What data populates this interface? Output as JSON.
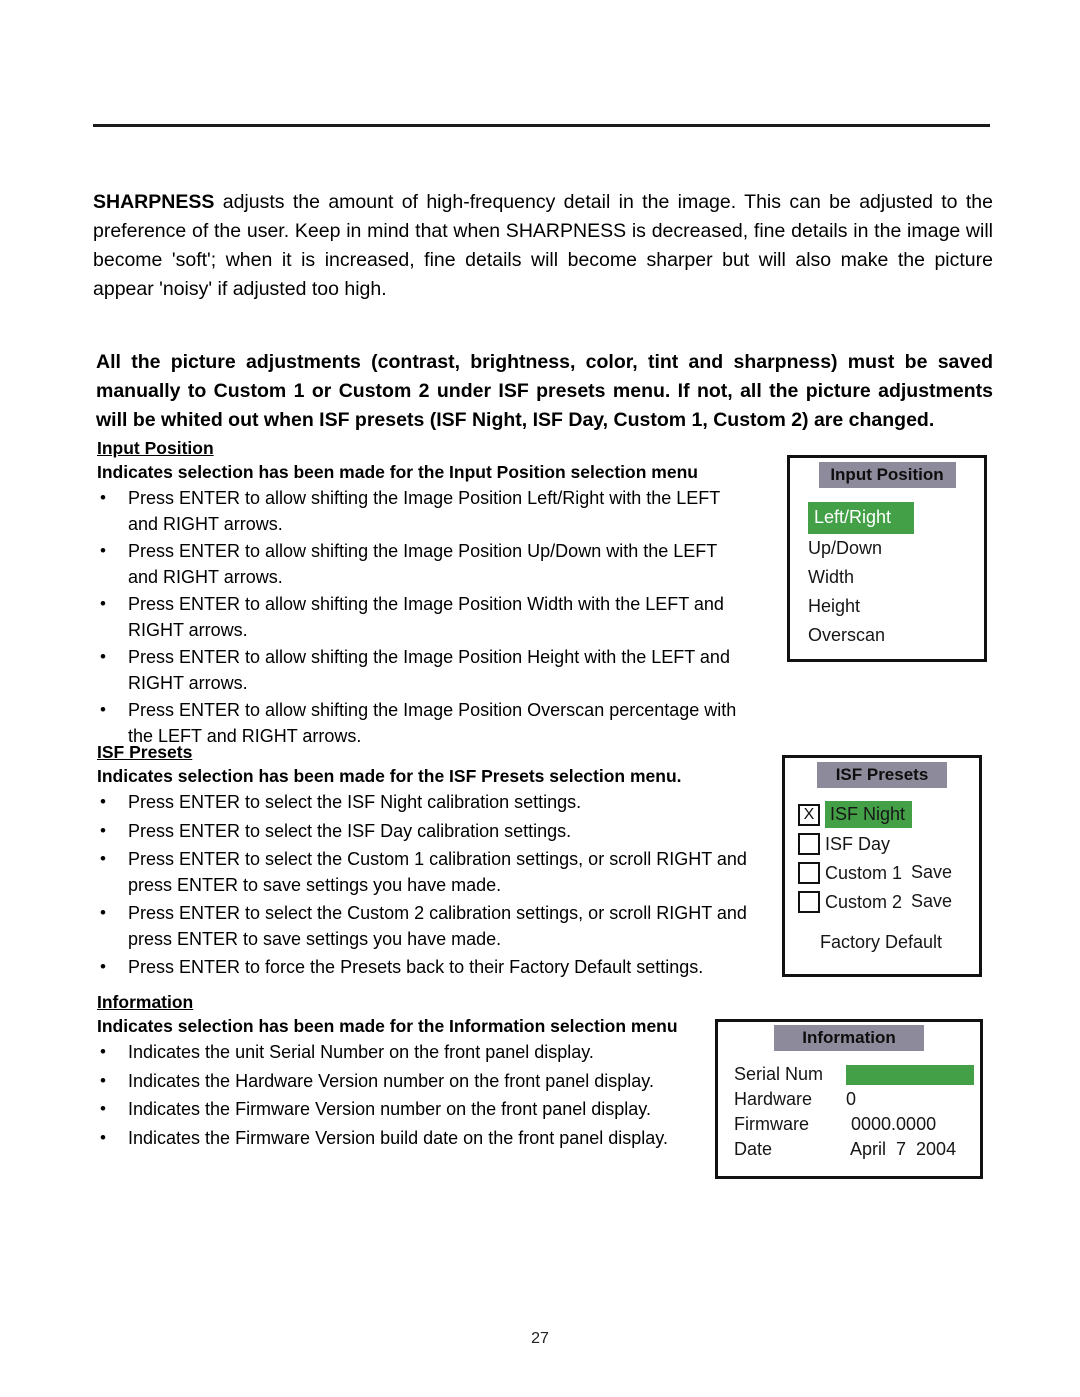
{
  "page": {
    "number": "27"
  },
  "intro": {
    "lead": "SHARPNESS",
    "rest": " adjusts the amount of high-frequency detail in the image. This can be adjusted to the preference of the user. Keep in mind that when SHARPNESS is decreased, fine details in the image will become 'soft'; when it is increased, fine details will become sharper but will also make the picture appear 'noisy' if adjusted too high."
  },
  "notice": {
    "text": "All the picture adjustments (contrast, brightness, color, tint and sharpness) must be saved manually to Custom 1 or Custom 2 under ISF presets menu. If not, all the picture adjustments will be whited out when ISF presets (ISF Night, ISF Day, Custom 1, Custom 2) are changed."
  },
  "sections": [
    {
      "title": "Input Position",
      "subtitle": "Indicates selection has been made for the Input Position selection menu",
      "bullets": [
        "Press ENTER to allow shifting the Image Position Left/Right with the LEFT and RIGHT arrows.",
        "Press ENTER to allow shifting the Image Position Up/Down with the LEFT and RIGHT arrows.",
        "Press ENTER to allow shifting the Image Position Width with the LEFT and RIGHT arrows.",
        "Press ENTER to allow shifting the Image Position Height with the LEFT and RIGHT arrows.",
        "Press ENTER to allow shifting the Image Position Overscan percentage with the LEFT and RIGHT arrows."
      ]
    },
    {
      "title": "ISF Presets",
      "subtitle": "Indicates selection has been made for the ISF Presets selection menu.",
      "bullets": [
        "Press ENTER to select the ISF Night calibration settings.",
        "Press ENTER to select the ISF Day calibration settings.",
        "Press ENTER to select the Custom 1 calibration settings, or scroll RIGHT and press ENTER to save settings you have made.",
        "Press ENTER to select the Custom 2 calibration settings, or scroll RIGHT and press ENTER to save settings you have made.",
        "Press ENTER to force the Presets back to their Factory Default settings."
      ]
    },
    {
      "title": "Information",
      "subtitle": "Indicates selection has been made for the Information selection menu",
      "bullets": [
        "Indicates the unit Serial Number on the front panel display.",
        "Indicates the Hardware Version number on the front panel display.",
        "Indicates the Firmware Version number on the front panel display.",
        "Indicates the Firmware Version build date on the front panel display."
      ]
    }
  ],
  "osd": {
    "colors": {
      "title_bar": "#8d8b9b",
      "highlight_green": "#43a047",
      "border": "#111111",
      "highlight_text": "#ffffff"
    },
    "input_position": {
      "title": "Input Position",
      "items": [
        {
          "label": "Left/Right",
          "selected": true
        },
        {
          "label": "Up/Down",
          "selected": false
        },
        {
          "label": "Width",
          "selected": false
        },
        {
          "label": "Height",
          "selected": false
        },
        {
          "label": "Overscan",
          "selected": false
        }
      ]
    },
    "isf_presets": {
      "title": "ISF Presets",
      "items": [
        {
          "label": "ISF Night",
          "checkmark": "X",
          "checked": true,
          "selected": true,
          "save": ""
        },
        {
          "label": "ISF Day",
          "checkmark": "",
          "checked": false,
          "selected": false,
          "save": ""
        },
        {
          "label": "Custom 1",
          "checkmark": "",
          "checked": false,
          "selected": false,
          "save": "Save"
        },
        {
          "label": "Custom 2",
          "checkmark": "",
          "checked": false,
          "selected": false,
          "save": "Save"
        }
      ],
      "factory_default": "Factory Default"
    },
    "information": {
      "title": "Information",
      "rows": [
        {
          "key": "Serial Num",
          "value": "",
          "bar": true
        },
        {
          "key": "Hardware",
          "value": "0",
          "bar": false
        },
        {
          "key": "Firmware",
          "value": " 0000.0000",
          "bar": false
        },
        {
          "key": "Date",
          "value": " April  7  2004",
          "bar": false
        }
      ]
    }
  }
}
